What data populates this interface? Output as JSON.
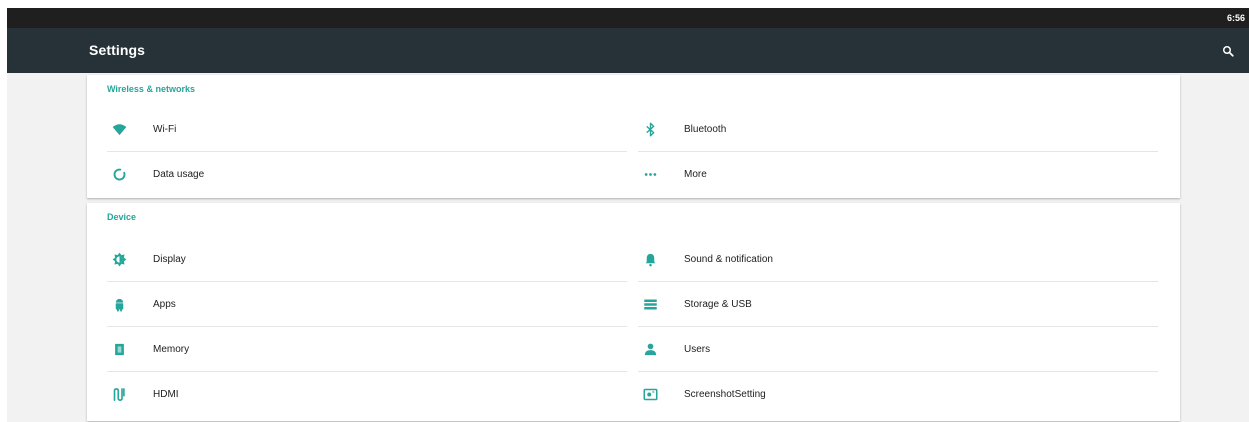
{
  "status_bar": {
    "time": "6:56"
  },
  "app_bar": {
    "title": "Settings",
    "search_icon": "search-icon"
  },
  "colors": {
    "accent": "#26a69a",
    "app_bar": "#263238",
    "status_bar": "#1f1f1f",
    "background": "#f2f2f2"
  },
  "sections": [
    {
      "header": "Wireless & networks",
      "items": [
        {
          "label": "Wi-Fi",
          "icon": "wifi-icon"
        },
        {
          "label": "Bluetooth",
          "icon": "bluetooth-icon"
        },
        {
          "label": "Data usage",
          "icon": "data-usage-icon"
        },
        {
          "label": "More",
          "icon": "more-icon"
        }
      ]
    },
    {
      "header": "Device",
      "items": [
        {
          "label": "Display",
          "icon": "display-icon"
        },
        {
          "label": "Sound & notification",
          "icon": "bell-icon"
        },
        {
          "label": "Apps",
          "icon": "android-icon"
        },
        {
          "label": "Storage & USB",
          "icon": "storage-icon"
        },
        {
          "label": "Memory",
          "icon": "memory-icon"
        },
        {
          "label": "Users",
          "icon": "person-icon"
        },
        {
          "label": "HDMI",
          "icon": "hdmi-icon"
        },
        {
          "label": "ScreenshotSetting",
          "icon": "screenshot-icon"
        }
      ]
    }
  ]
}
